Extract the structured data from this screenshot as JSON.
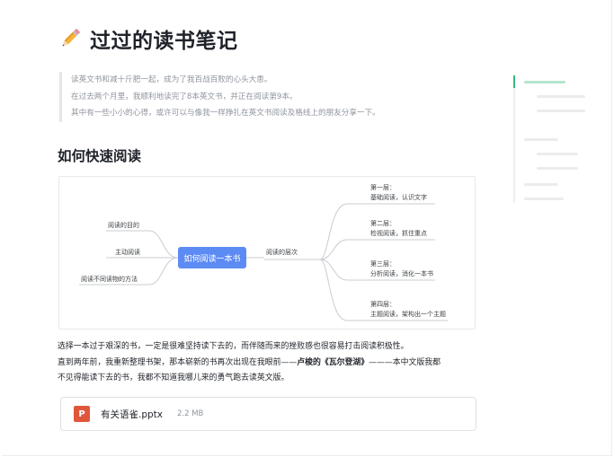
{
  "page": {
    "title_icon": "pencil-icon",
    "title": "过过的读书笔记"
  },
  "quote": [
    "读英文书和减十斤肥一起，成为了我百战百败的心头大患。",
    "在过去两个月里，我顺利地读完了8本英文书，并正在阅读第9本。",
    "其中有一些小小的心得，或许可以与像我一样挣扎在英文书阅读及格线上的朋友分享一下。"
  ],
  "section": {
    "heading": "如何快速阅读"
  },
  "mindmap": {
    "root": "如何阅读一本书",
    "left": [
      "阅读的目的",
      "主动阅读",
      "阅读不同读物的方法"
    ],
    "right_branch": "阅读的层次",
    "levels": [
      {
        "name": "第一层：",
        "desc": "基础阅读，认识文字"
      },
      {
        "name": "第二层：",
        "desc": "检视阅读，抓住重点"
      },
      {
        "name": "第三层：",
        "desc": "分析阅读，消化一本书"
      },
      {
        "name": "第四层：",
        "desc": "主题阅读，架构出一个主题"
      }
    ],
    "colors": {
      "root_bg": "#5d8bf4",
      "line": "#c9ccd1"
    }
  },
  "paragraph": {
    "line1": "选择一本过于艰深的书，一定是很难坚持读下去的，而伴随而来的挫败感也很容易打击阅读积极性。",
    "line2_pre": "直到两年前，我重新整理书架，那本崭新的书再次出现在我眼前——",
    "line2_bold": "卢梭的《瓦尔登湖》",
    "line2_post": "———本中文版我都",
    "line3": "不见得能读下去的书，我都不知道我哪儿来的勇气跑去读英文版。"
  },
  "attachment": {
    "icon": "powerpoint-file-icon",
    "icon_letter": "P",
    "name": "有关语雀.pptx",
    "size": "2.2 MB",
    "icon_color": "#e0563b"
  },
  "toc": {
    "accent": "#39b77b"
  }
}
